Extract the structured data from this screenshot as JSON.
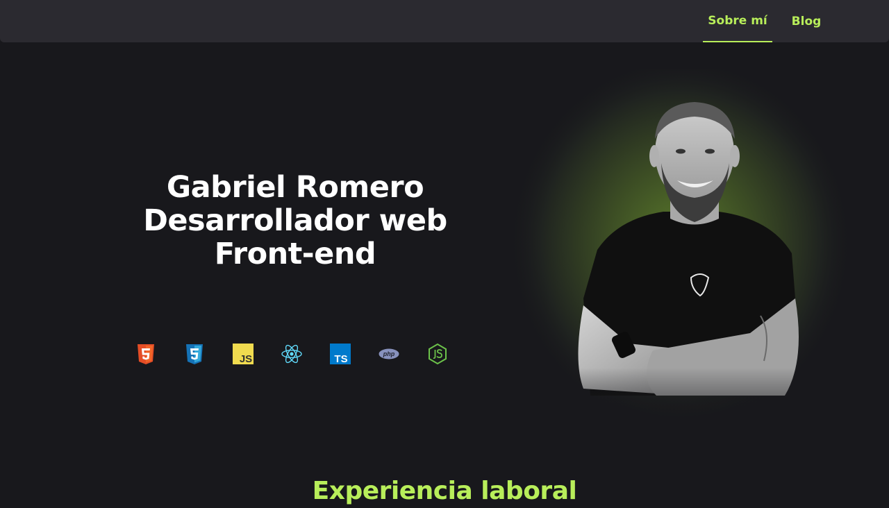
{
  "nav": {
    "items": [
      {
        "label": "Sobre mí",
        "active": true
      },
      {
        "label": "Blog",
        "active": false
      }
    ]
  },
  "hero": {
    "title_lines": [
      "Gabriel Romero",
      "Desarrollador web",
      "Front-end"
    ]
  },
  "tech_icons": [
    "html5-icon",
    "css3-icon",
    "javascript-icon",
    "react-icon",
    "typescript-icon",
    "php-icon",
    "nodejs-icon"
  ],
  "tech_labels": {
    "javascript": "JS",
    "typescript": "TS",
    "php": "php"
  },
  "experience": {
    "title": "Experiencia laboral"
  },
  "colors": {
    "background": "#18181c",
    "navbar": "#2b2a30",
    "accent": "#b8ee5a",
    "text": "#ffffff"
  }
}
